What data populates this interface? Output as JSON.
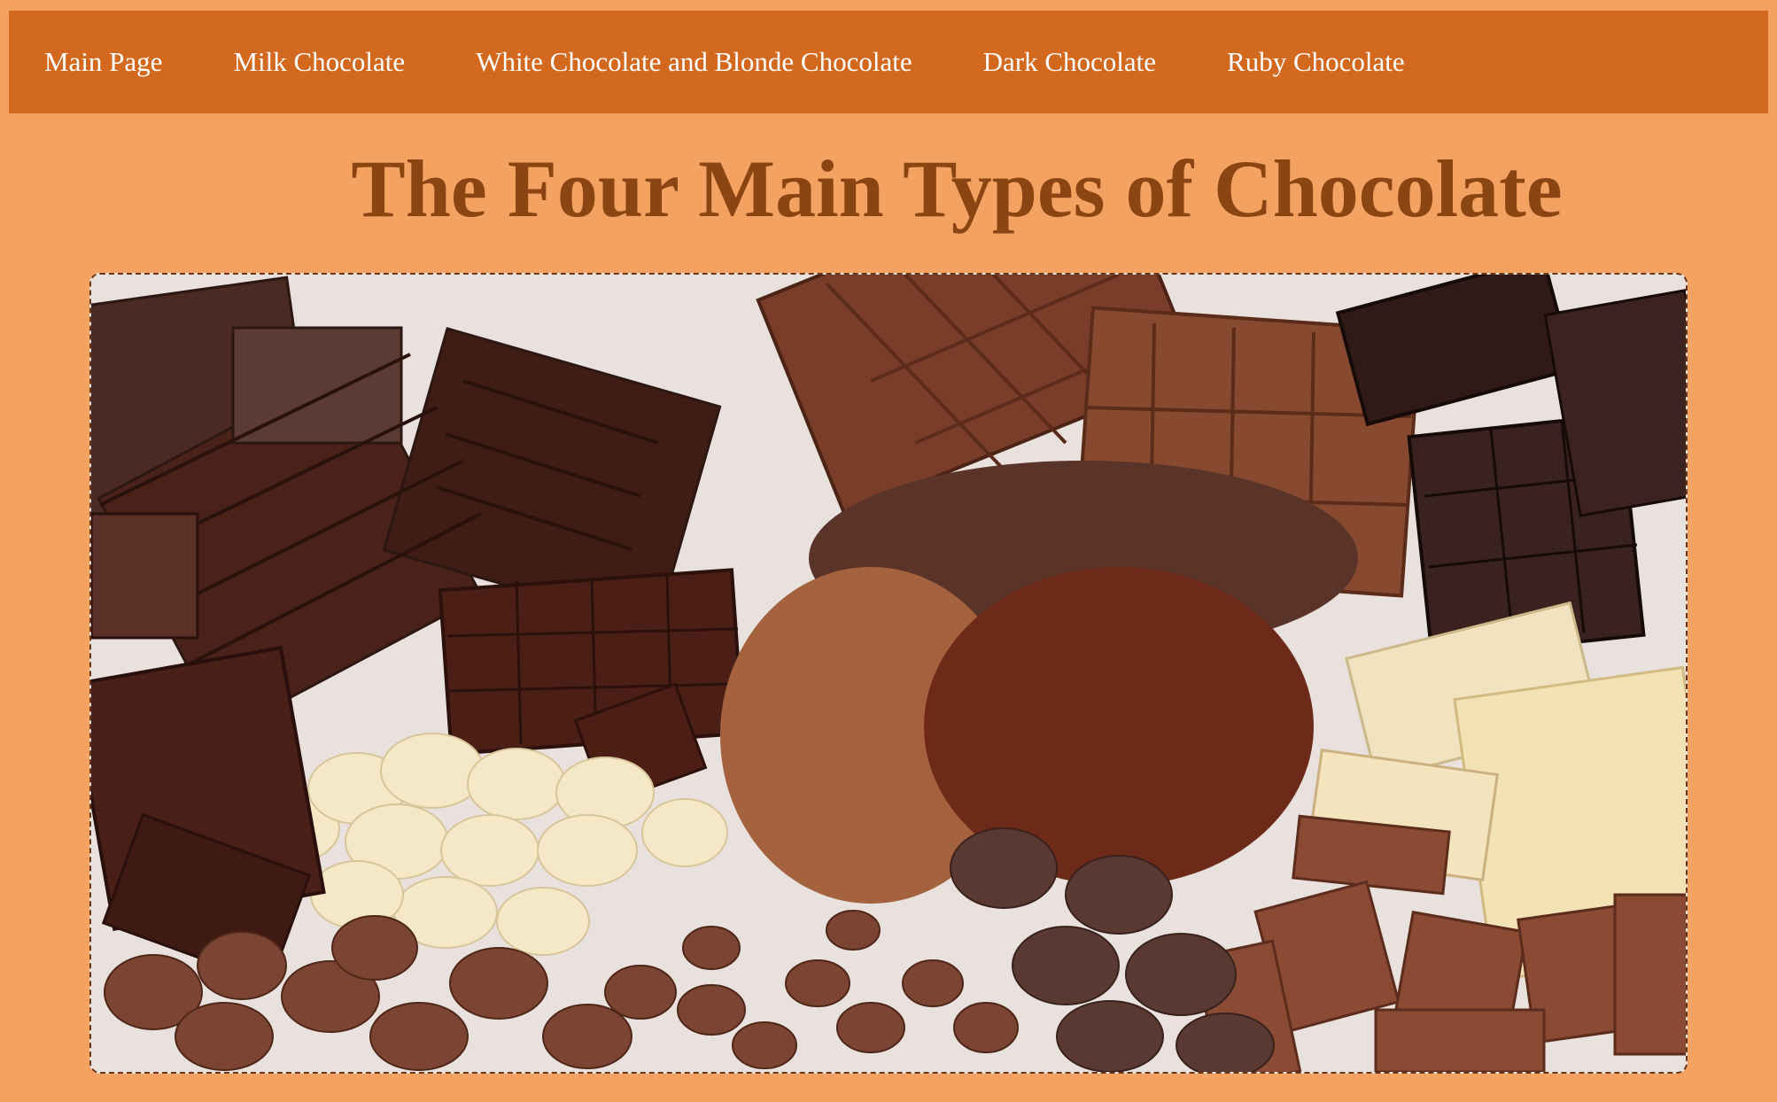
{
  "nav": {
    "items": [
      {
        "label": "Main Page"
      },
      {
        "label": "Milk Chocolate"
      },
      {
        "label": "White Chocolate and Blonde Chocolate"
      },
      {
        "label": "Dark Chocolate"
      },
      {
        "label": "Ruby Chocolate"
      }
    ]
  },
  "page": {
    "title": "The Four Main Types of Chocolate"
  },
  "colors": {
    "background": "#f4a261",
    "navbar": "#d2691e",
    "title": "#8b4513",
    "nav_text": "#ffffff"
  }
}
